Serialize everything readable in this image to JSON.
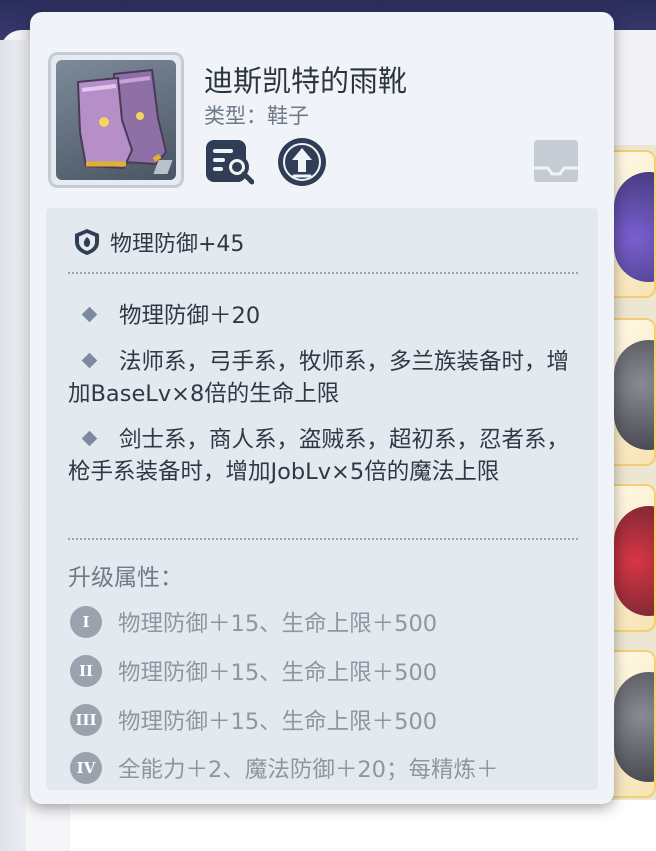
{
  "item": {
    "name": "迪斯凯特的雨靴",
    "type": "类型：鞋子"
  },
  "base_stat": "物理防御+45",
  "effects": [
    "物理防御＋20",
    "法师系，弓手系，牧师系，多兰族装备时，增加BaseLv×8倍的生命上限",
    "剑士系，商人系，盗贼系，超初系，忍者系，枪手系装备时，增加JobLv×5倍的魔法上限"
  ],
  "upgrade": {
    "title": "升级属性：",
    "levels": [
      {
        "numeral": "I",
        "text": "物理防御＋15、生命上限＋500"
      },
      {
        "numeral": "II",
        "text": "物理防御＋15、生命上限＋500"
      },
      {
        "numeral": "III",
        "text": "物理防御＋15、生命上限＋500"
      },
      {
        "numeral": "IV",
        "text": "全能力＋2、魔法防御＋20；每精炼＋"
      }
    ]
  },
  "icons": {
    "item": "rain-boots-icon",
    "detail": "magnifier-document-icon",
    "upgrade": "upgrade-arrow-icon",
    "storage": "storage-tray-icon",
    "base_stat": "shield-icon",
    "bullet": "diamond-bullet-icon"
  },
  "colors": {
    "card_bg": "#f0f4f8",
    "props_bg": "#e4e9f0",
    "text_primary": "#2f3844",
    "text_secondary": "#6f7a88",
    "icon_dark": "#2f3e54",
    "backdrop": "#2a2c57"
  }
}
